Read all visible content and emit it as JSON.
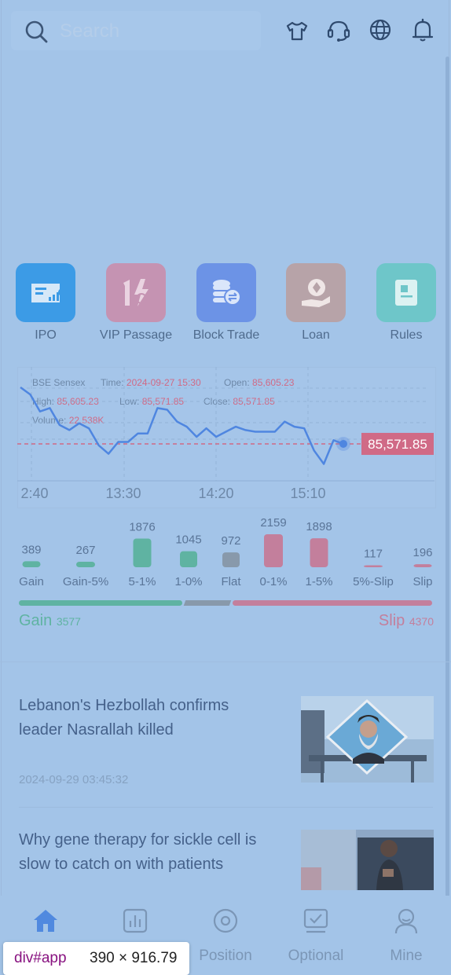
{
  "search": {
    "placeholder": "Search"
  },
  "header_icons": [
    "tshirt-icon",
    "headset-icon",
    "globe-icon",
    "bell-icon"
  ],
  "quick_actions": [
    {
      "label": "IPO",
      "icon": "ticket-chart-icon",
      "color": "#3c9be6"
    },
    {
      "label": "VIP Passage",
      "icon": "lightning-16-icon",
      "color": "#c593b2"
    },
    {
      "label": "Block Trade",
      "icon": "coins-exchange-icon",
      "color": "#6c93e6"
    },
    {
      "label": "Loan",
      "icon": "hand-coin-icon",
      "color": "#b7a3a8"
    },
    {
      "label": "Rules",
      "icon": "book-icon",
      "color": "#6ec6c9"
    }
  ],
  "quote": {
    "name": "BSE Sensex",
    "time_label": "Time:",
    "time": "2024-09-27 15:30",
    "open_label": "Open:",
    "open": "85,605.23",
    "high_label": "High:",
    "high": "85,605.23",
    "low_label": "Low:",
    "low": "85,571.85",
    "close_label": "Close:",
    "close": "85,571.85",
    "volume_label": "Volume:",
    "volume": "22.538K",
    "last_price": "85,571.85"
  },
  "chart_data": [
    {
      "type": "line",
      "title": "BSE Sensex",
      "x_ticks": [
        "2:40",
        "13:30",
        "14:20",
        "15:10"
      ],
      "y": [
        85605.23,
        85601,
        85591,
        85593,
        85583,
        85580,
        85584,
        85581,
        85571,
        85566,
        85573,
        85573,
        85578,
        85578,
        85593,
        85592,
        85585,
        85582,
        85576,
        85581,
        85576,
        85579,
        85582,
        85580,
        85579,
        85579,
        85579,
        85585,
        85582,
        85581,
        85568,
        85560,
        85574,
        85571.85
      ],
      "reference_line": 85571.85,
      "last_label": "85,571.85",
      "colors": {
        "line": "#4f86e0",
        "reference": "#d06a86"
      }
    },
    {
      "type": "bar",
      "categories": [
        "Gain",
        "Gain-5%",
        "5-1%",
        "1-0%",
        "Flat",
        "0-1%",
        "1-5%",
        "5%-Slip",
        "Slip"
      ],
      "values": [
        389,
        267,
        1876,
        1045,
        972,
        2159,
        1898,
        117,
        196
      ],
      "colors": [
        "#5fb3a2",
        "#5fb3a2",
        "#5fb3a2",
        "#5fb3a2",
        "#8899ab",
        "#c37f9c",
        "#c37f9c",
        "#c37f9c",
        "#c37f9c"
      ]
    }
  ],
  "breadth": {
    "gain_label": "Gain",
    "gain_count": "3577",
    "slip_label": "Slip",
    "slip_count": "4370",
    "gain_color": "#5fb3a2",
    "slip_color": "#c37f9c"
  },
  "news": [
    {
      "title": "Lebanon's Hezbollah confirms leader Nasrallah killed",
      "time": "2024-09-29 03:45:32"
    },
    {
      "title": "Why gene therapy for sickle cell is slow to catch on with patients",
      "time": ""
    }
  ],
  "nav": [
    {
      "label": "",
      "icon": "home-icon",
      "active": true
    },
    {
      "label": "",
      "icon": "market-chart-icon"
    },
    {
      "label": "Position",
      "icon": "position-icon"
    },
    {
      "label": "Optional",
      "icon": "optional-check-icon"
    },
    {
      "label": "Mine",
      "icon": "user-icon"
    }
  ],
  "devtools": {
    "element": "div#app",
    "size": "390 × 916.79"
  }
}
